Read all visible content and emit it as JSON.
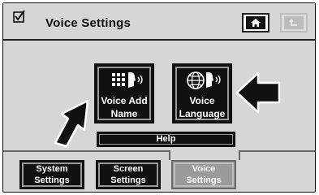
{
  "header": {
    "title": "Voice Settings",
    "home_icon": "home-icon",
    "back_icon": "back-arrow-icon"
  },
  "main": {
    "voice_add_name": {
      "label": "Voice Add\nName",
      "icon": "keypad-speaking-head-icon"
    },
    "voice_language": {
      "label": "Voice\nLanguage",
      "icon": "globe-speaking-head-icon"
    },
    "help_label": "Help"
  },
  "tabs": [
    {
      "label": "System\nSettings",
      "active": false
    },
    {
      "label": "Screen\nSettings",
      "active": false
    },
    {
      "label": "Voice\nSettings",
      "active": true
    }
  ],
  "colors": {
    "background": "#d6d6d6",
    "button": "#111111",
    "active_tab": "#9a9a9a"
  }
}
